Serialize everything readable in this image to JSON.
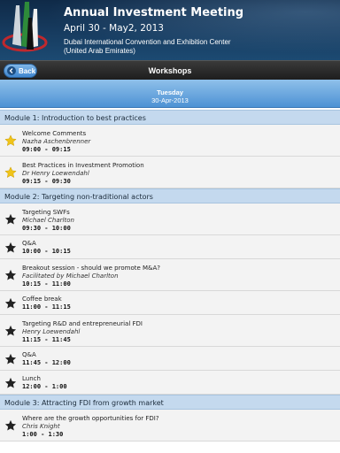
{
  "header": {
    "title": "Annual Investment Meeting",
    "dates": "April 30 - May2, 2013",
    "venue": "Dubai International Convention and Exhibition Center (United Arab Emirates)"
  },
  "navbar": {
    "back_label": "Back",
    "title": "Workshops"
  },
  "day": {
    "name": "Tuesday",
    "date": "30-Apr-2013"
  },
  "colors": {
    "star_favorite": "#f0c419",
    "star_default": "#222222",
    "module_bg": "#c4d9ee",
    "accent": "#4d92d4"
  },
  "modules": [
    {
      "title": "Module 1: Introduction to best practices",
      "sessions": [
        {
          "title": "Welcome Comments",
          "speaker": "Nazha Aschenbrenner",
          "time": "09:00 - 09:15",
          "favorite": true
        },
        {
          "title": "Best Practices in Investment Promotion",
          "speaker": "Dr Henry Loewendahl",
          "time": "09:15 - 09:30",
          "favorite": true
        }
      ]
    },
    {
      "title": "Module 2: Targeting non-traditional actors",
      "sessions": [
        {
          "title": "Targeting SWFs",
          "speaker": "Michael Charlton",
          "time": "09:30 - 10:00",
          "favorite": false
        },
        {
          "title": "Q&A",
          "speaker": "",
          "time": "10:00 - 10:15",
          "favorite": false
        },
        {
          "title": "Breakout session - should we promote M&A?",
          "speaker": "Facilitated by Michael Charlton",
          "time": "10:15 - 11:00",
          "favorite": false
        },
        {
          "title": "Coffee break",
          "speaker": "",
          "time": "11:00 - 11:15",
          "favorite": false
        },
        {
          "title": "Targeting R&D and entrepreneurial FDI",
          "speaker": "Henry Loewendahl",
          "time": "11:15 - 11:45",
          "favorite": false
        },
        {
          "title": "Q&A",
          "speaker": "",
          "time": "11:45 - 12:00",
          "favorite": false
        },
        {
          "title": "Lunch",
          "speaker": "",
          "time": "12:00 - 1:00",
          "favorite": false
        }
      ]
    },
    {
      "title": "Module 3: Attracting FDI from growth market",
      "sessions": [
        {
          "title": "Where are the growth opportunities for FDI?",
          "speaker": "Chris Knight",
          "time": "1:00 - 1:30",
          "favorite": false
        }
      ]
    }
  ]
}
